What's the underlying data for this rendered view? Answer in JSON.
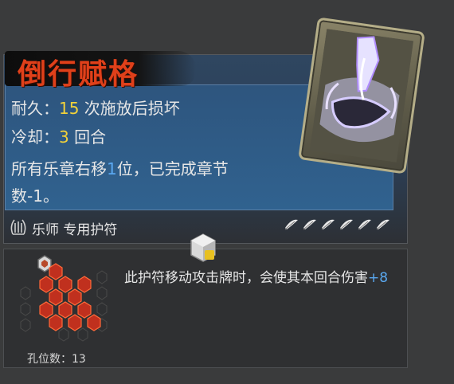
{
  "card": {
    "title": "倒行赋格",
    "durability_label": "耐久：",
    "durability_value": "15",
    "durability_suffix": " 次施放后损坏",
    "cooldown_label": "冷却：",
    "cooldown_value": "3",
    "cooldown_suffix": " 回合",
    "desc_line1_a": "所有乐章右移",
    "desc_line1_num": "1",
    "desc_line1_b": "位，已完成章节",
    "desc_line2": "数-1。",
    "class_label": "乐师 专用护符",
    "feather_count": 6
  },
  "socket": {
    "effect_text": "此护符移动攻击牌时，会使其本回合伤害",
    "effect_bonus": "+8",
    "holes_label": "孔位数：13"
  },
  "colors": {
    "title": "#e0401a",
    "highlight_yellow": "#f2d23a",
    "highlight_blue": "#5aa8f0",
    "hex_red": "#c0301e"
  },
  "icons": [
    "lyre-class-icon",
    "feather-icon",
    "cube-icon",
    "card-art-icon"
  ]
}
